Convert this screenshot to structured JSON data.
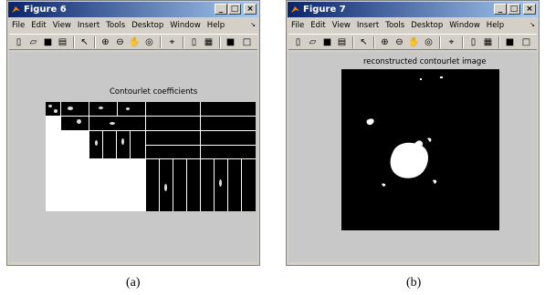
{
  "menus": [
    "File",
    "Edit",
    "View",
    "Insert",
    "Tools",
    "Desktop",
    "Window",
    "Help"
  ],
  "window_a": {
    "title": "Figure 6",
    "axes_title": "Contourlet coefficients",
    "caption": "(a)"
  },
  "window_b": {
    "title": "Figure 7",
    "axes_title": "reconstructed contourlet image",
    "caption": "(b)"
  },
  "toolbar_icons": [
    "new-icon",
    "open-icon",
    "save-icon",
    "print-icon",
    "pointer-icon",
    "zoom-in-icon",
    "zoom-out-icon",
    "pan-icon",
    "rotate-icon",
    "data-cursor-icon",
    "colorbar-icon",
    "legend-icon",
    "hide-plot-tools-icon",
    "show-plot-tools-icon"
  ],
  "colors": {
    "titlebar_start": "#0a246a",
    "titlebar_end": "#a6caf0",
    "canvas": "#c8c8c8",
    "window": "#d4d0c8"
  }
}
